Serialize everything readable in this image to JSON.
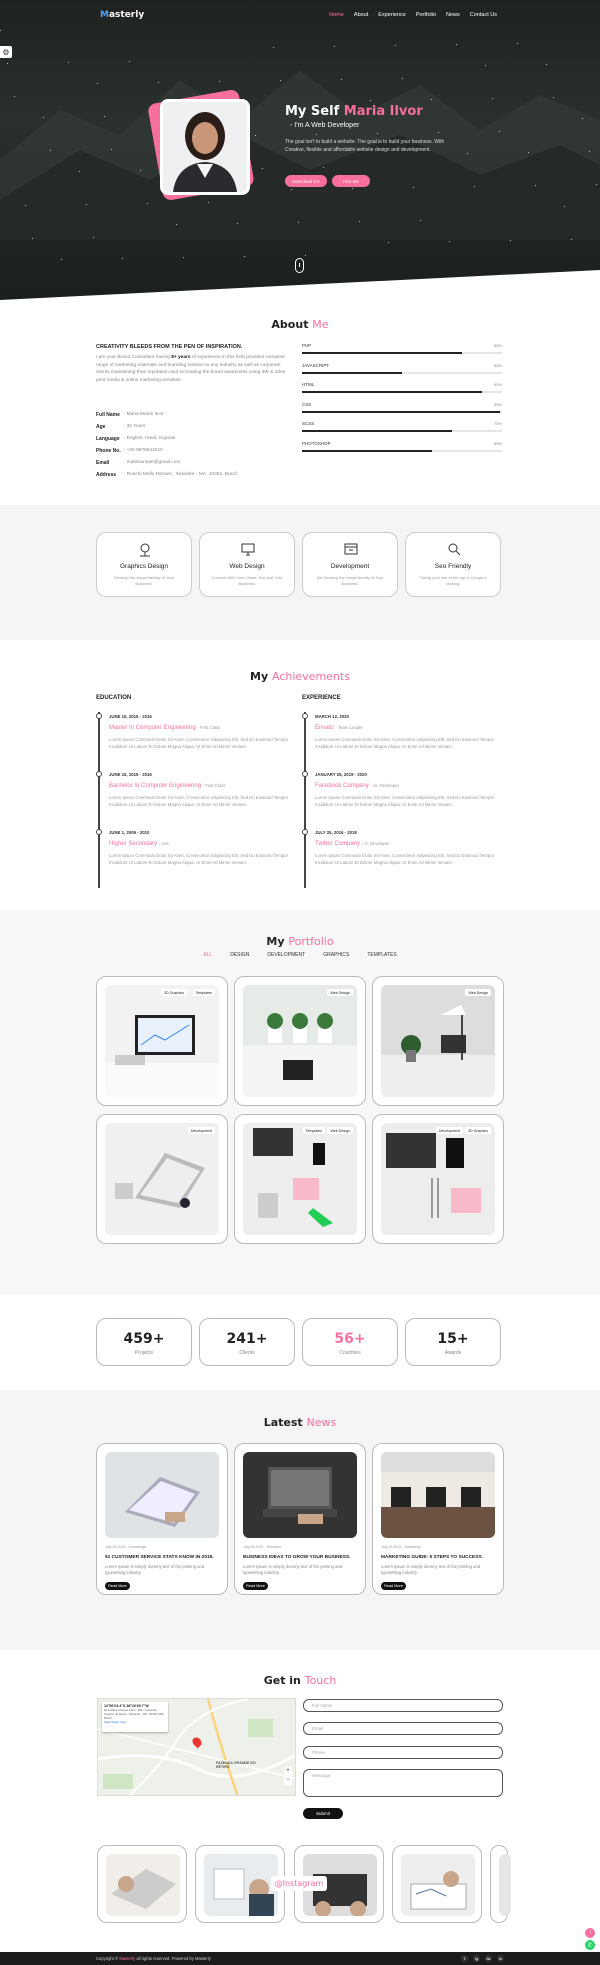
{
  "nav": {
    "logo_first": "M",
    "logo_rest": "asterly",
    "items": [
      "Home",
      "About",
      "Experience",
      "Portfolio",
      "News",
      "Contact Us"
    ]
  },
  "hero": {
    "title_a": "My Self ",
    "title_b": "Maria Ilvor",
    "subtitle": "- I'm A Web Developer",
    "desc": "The goal isn't to build a website. The goal is to build your business. With Creative, flexible and affordable website design and development.",
    "btn1": "Download CV",
    "btn2": "Hire Me"
  },
  "about": {
    "title_a": "About ",
    "title_b": "Me",
    "heading": "CREATIVITY BLEEDS FROM THE PEN OF INSPIRATION.",
    "para_a": "I am your Brand Consultant having ",
    "para_b": "8+ years",
    "para_c": " of experience in this field provides complete range of marketing materials and branding solution to any industry as well as corporate clients maintaining their reputation and increasing the brand awareness using 3W & other print media & online marketing activities.",
    "info": [
      {
        "k": "Full Name",
        "v": ": Maria Martin Ilvor"
      },
      {
        "k": "Age",
        "v": ": 30 Years"
      },
      {
        "k": "Language",
        "v": ": English, Hindi, Gujarati"
      },
      {
        "k": "Phone No.",
        "v": ": +00 9876543210"
      },
      {
        "k": "Email",
        "v": ": mailexample@gmail.com"
      },
      {
        "k": "Address",
        "v": ": Ruachi Mello Moraes , Salvador - MA, 40352, Brazil"
      }
    ],
    "skills": [
      {
        "name": "PHP",
        "pct": "80%",
        "val": 0.8
      },
      {
        "name": "JAVASCRIPT",
        "pct": "50%",
        "val": 0.5
      },
      {
        "name": "HTML",
        "pct": "90%",
        "val": 0.9
      },
      {
        "name": "CSS",
        "pct": "99%",
        "val": 0.99
      },
      {
        "name": "SCSS",
        "pct": "75%",
        "val": 0.75
      },
      {
        "name": "PHOTOSHOP",
        "pct": "65%",
        "val": 0.65
      }
    ]
  },
  "services": [
    {
      "title": "Graphics Design",
      "desc": "Develop the visual identity of Your Business.",
      "icon": "graphics-design-icon"
    },
    {
      "title": "Web Design",
      "desc": "Connect With Your Users, Not Just Your Business.",
      "icon": "web-design-icon"
    },
    {
      "title": "Development",
      "desc": "We Develop the visual identity of Your Business.",
      "icon": "development-icon"
    },
    {
      "title": "Seo Friendly",
      "desc": "Taking your site at the top of Google's ranking.",
      "icon": "seo-icon"
    }
  ],
  "achievements": {
    "title_a": "My ",
    "title_b": "Achievements",
    "edu_head": "EDUCATION",
    "exp_head": "EXPERIENCE",
    "desc": "Lorem Ipsum Commodo Dolor Sit Amet, Consectetur Adipisicing Elit, Sed Do Eiusmod Tempor Incididunt Ut Labore Et Dolore Magna Aliqua. Ut Enim Ad Minim Veniam.",
    "education": [
      {
        "date": "JUNE 15, 2015 - 2016",
        "title": "Master In Computer Engineering",
        "sub": "- First Class"
      },
      {
        "date": "JUNE 15, 2015 - 2016",
        "title": "Bachelor In Computer Engineering",
        "sub": "- First Class"
      },
      {
        "date": "JUNE 1, 2009 - 2010",
        "title": "Higher Secondary",
        "sub": "- Arts"
      }
    ],
    "experience": [
      {
        "date": "MARCH 12, 2020",
        "title": "Envato",
        "sub": "- Team Leader"
      },
      {
        "date": "JANUARY 25, 2019 - 2020",
        "title": "Facebook Company",
        "sub": "- Sr. Developer"
      },
      {
        "date": "JULY 25, 2016 - 2018",
        "title": "Twitter Company",
        "sub": "- Jr. Developer"
      }
    ]
  },
  "portfolio": {
    "title_a": "My ",
    "title_b": "Portfolio",
    "filters": [
      "ALL",
      "DESIGN",
      "DEVELOPMENT",
      "GRAPHICS",
      "TEMPLATES"
    ],
    "items": [
      {
        "tags": [
          "3D Graphics",
          "Templates"
        ]
      },
      {
        "tags": [
          "Web Design"
        ]
      },
      {
        "tags": [
          "Web Design"
        ]
      },
      {
        "tags": [
          "Development"
        ]
      },
      {
        "tags": [
          "Templates",
          "Web Design"
        ]
      },
      {
        "tags": [
          "Development",
          "3D Graphics"
        ]
      }
    ]
  },
  "stats": [
    {
      "n": "459+",
      "l": "Projects"
    },
    {
      "n": "241+",
      "l": "Clients"
    },
    {
      "n": "56+",
      "l": "Countries"
    },
    {
      "n": "15+",
      "l": "Awards"
    }
  ],
  "news": {
    "title_a": "Latest ",
    "title_b": "News",
    "items": [
      {
        "meta": "July 25,2019 - Knowledge",
        "title": "51 CUSTOMER SERVICE STATS KNOW IN 2019.",
        "desc": "Lorem Ipsum is simply dummy text of the printing and typesetting industry."
      },
      {
        "meta": "July 25,2019 - Business",
        "title": "BUSINESS IDEAS TO GROW YOUR BUSINESS.",
        "desc": "Lorem Ipsum is simply dummy text of the printing and typesetting industry."
      },
      {
        "meta": "July 25,2019 - Marketing",
        "title": "MARKETING GUIDE: 5 STEPS TO SUCCESS.",
        "desc": "Lorem Ipsum is simply dummy text of the printing and typesetting industry."
      }
    ],
    "read_more": "Read More"
  },
  "contact": {
    "title_a": "Get in ",
    "title_b": "Touch",
    "map_coords": "12°56'03.4\"S 38°26'45.7\"W",
    "map_addr": "Rua Mello Moraes Filho, 189 - Fazenda Grande do Retiro, Salvador - BA, 40352-000, Brazil",
    "map_link": "View larger map",
    "map_place": "FAZENDA GRANDE DO RETIRO",
    "fields": [
      "Full Name",
      "Email",
      "Phone",
      "Message"
    ],
    "submit": "Submit"
  },
  "instagram": {
    "label": "@Instagram"
  },
  "footer": {
    "copy_a": "Copyright © ",
    "copy_b": "Masterly",
    "copy_c": " all rights reserved. Powered by Masterly",
    "social": [
      "f",
      "ig",
      "tw",
      "in"
    ]
  }
}
